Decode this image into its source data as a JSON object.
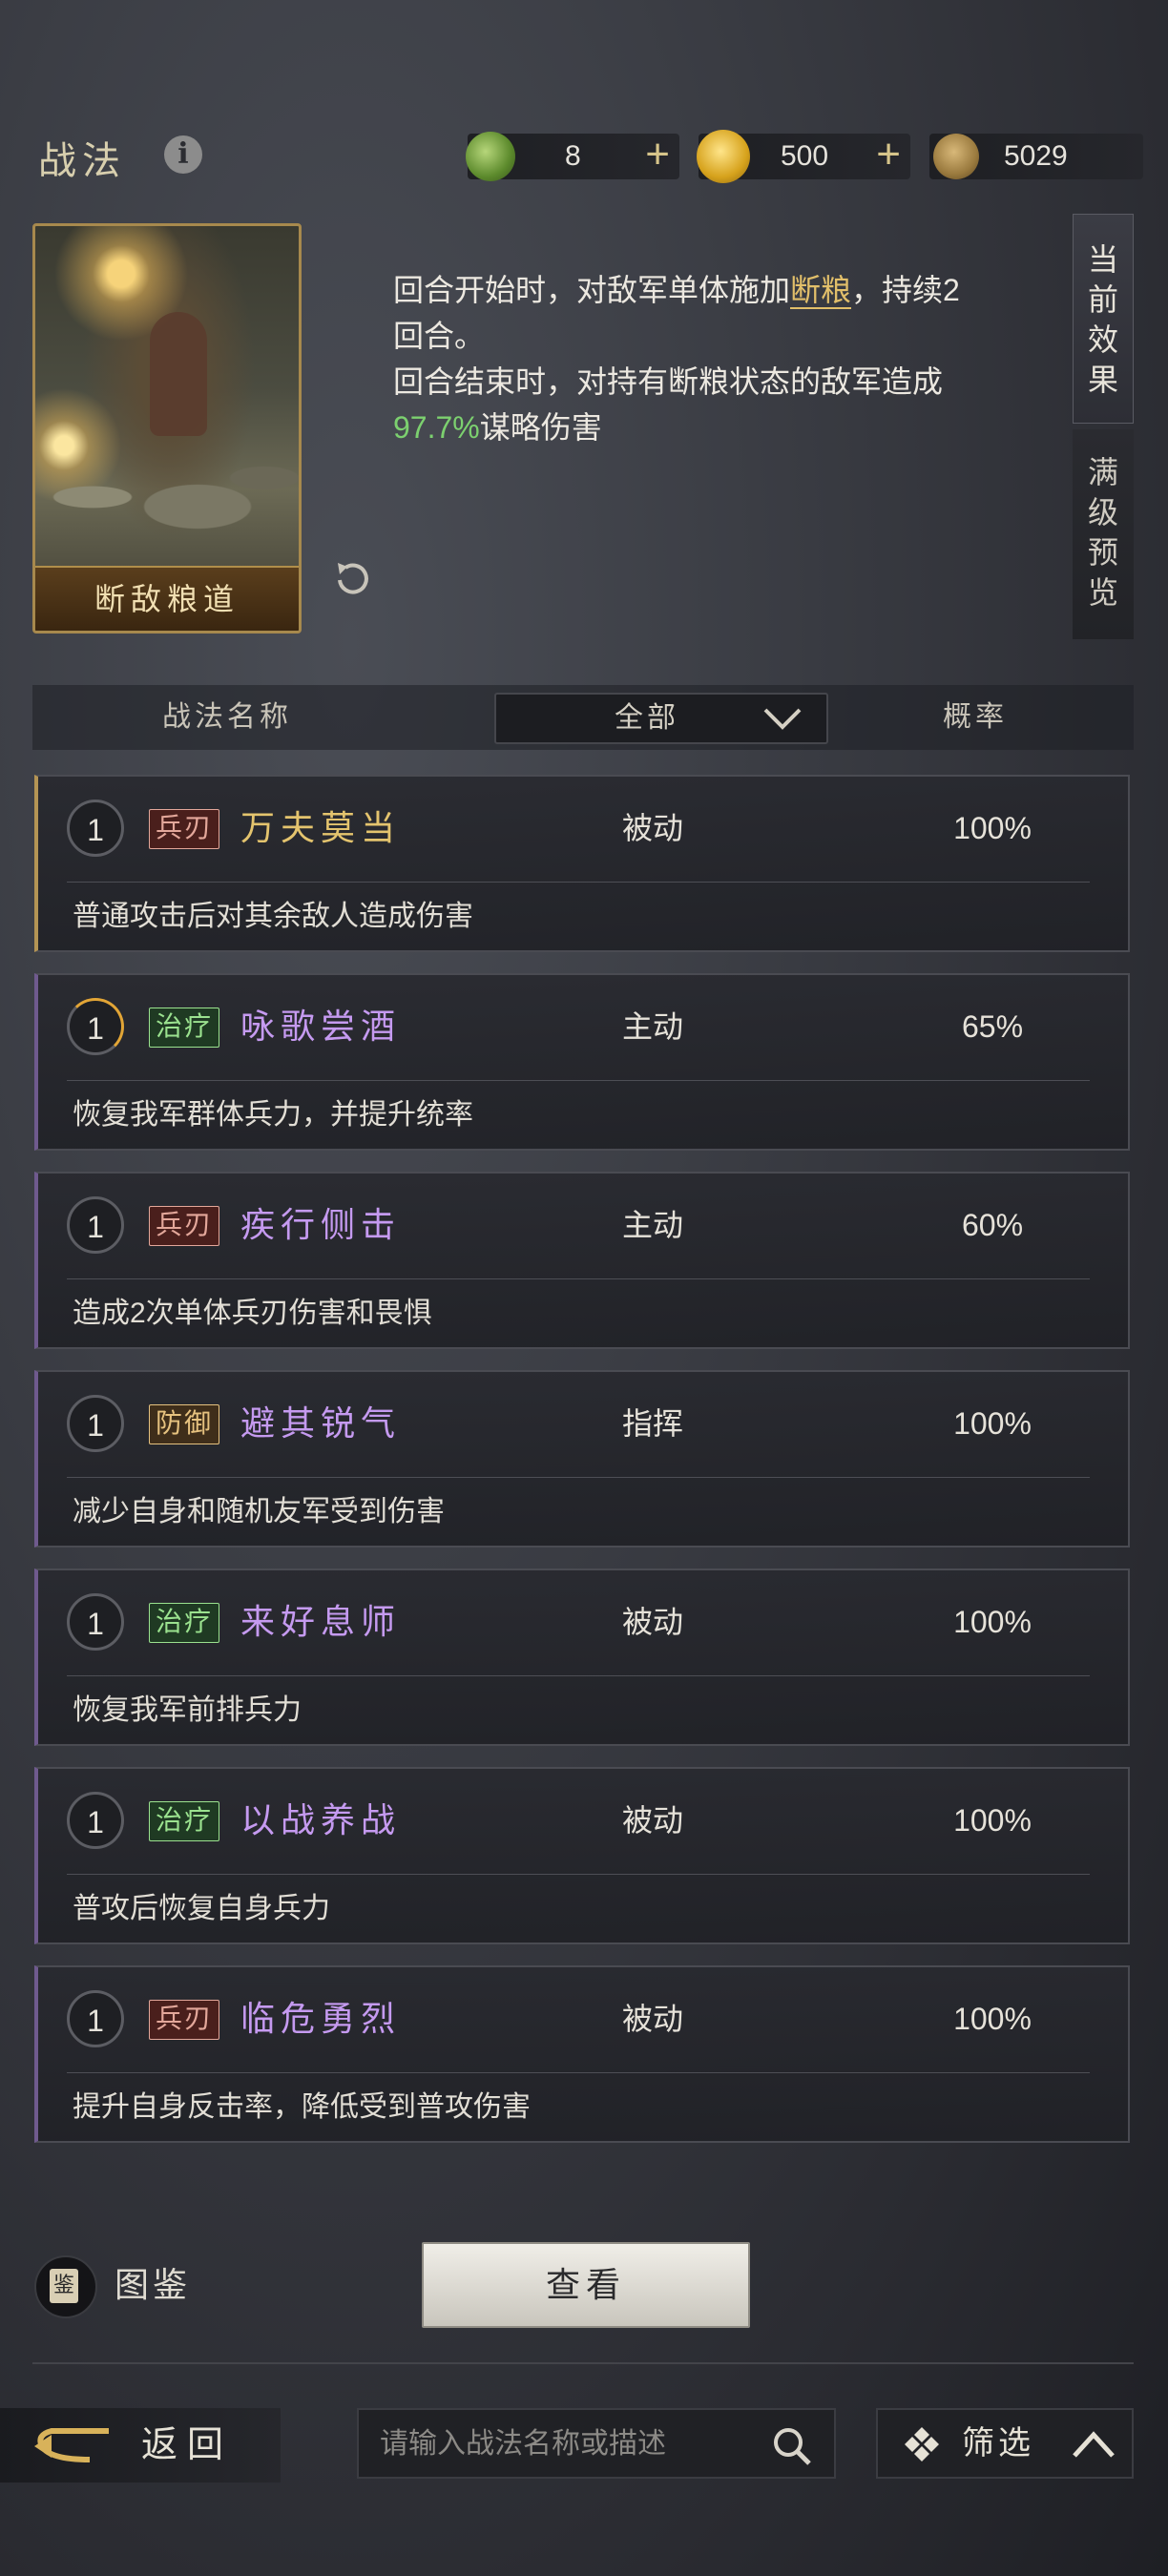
{
  "header": {
    "title": "战法",
    "resources": [
      {
        "icon": "jade-coin-icon",
        "value": "8",
        "plus": "+"
      },
      {
        "icon": "gold-coin-icon",
        "value": "500",
        "plus": "+"
      },
      {
        "icon": "copper-coin-icon",
        "value": "5029"
      }
    ]
  },
  "detail": {
    "card_name": "断敌粮道",
    "line1_a": "回合开始时，对敌军单体施加",
    "line1_hl": "断粮",
    "line1_b": "，持续2",
    "line2": "回合。",
    "line3": "回合结束时，对持有断粮状态的敌军造成",
    "line4_pct": "97.7%",
    "line4_b": "谋略伤害"
  },
  "side_tabs": {
    "current": [
      "当",
      "前",
      "效",
      "果"
    ],
    "max_preview": [
      "满",
      "级",
      "预",
      "览"
    ]
  },
  "table_header": {
    "name": "战法名称",
    "filter": "全部",
    "prob": "概率"
  },
  "rows": [
    {
      "level": "1",
      "tag": "兵刃",
      "name": "万夫莫当",
      "type": "被动",
      "prob": "100%",
      "desc": "普通攻击后对其余敌人造成伤害"
    },
    {
      "level": "1",
      "tag": "治疗",
      "name": "咏歌尝酒",
      "type": "主动",
      "prob": "65%",
      "desc": "恢复我军群体兵力，并提升统率"
    },
    {
      "level": "1",
      "tag": "兵刃",
      "name": "疾行侧击",
      "type": "主动",
      "prob": "60%",
      "desc": "造成2次单体兵刃伤害和畏惧"
    },
    {
      "level": "1",
      "tag": "防御",
      "name": "避其锐气",
      "type": "指挥",
      "prob": "100%",
      "desc": "减少自身和随机友军受到伤害"
    },
    {
      "level": "1",
      "tag": "治疗",
      "name": "来好息师",
      "type": "被动",
      "prob": "100%",
      "desc": "恢复我军前排兵力"
    },
    {
      "level": "1",
      "tag": "治疗",
      "name": "以战养战",
      "type": "被动",
      "prob": "100%",
      "desc": "普攻后恢复自身兵力"
    },
    {
      "level": "1",
      "tag": "兵刃",
      "name": "临危勇烈",
      "type": "被动",
      "prob": "100%",
      "desc": "提升自身反击率，降低受到普攻伤害"
    }
  ],
  "bottom": {
    "tujian_icon_char": "鉴",
    "tujian": "图鉴",
    "view": "查看",
    "back": "返回",
    "search_placeholder": "请输入战法名称或描述",
    "filter": "筛选"
  }
}
